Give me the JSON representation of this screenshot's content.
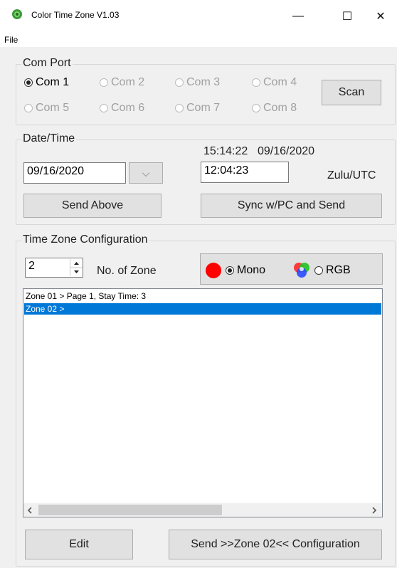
{
  "window": {
    "title": "Color Time Zone V1.03",
    "minimize_glyph": "—",
    "maximize_glyph": "☐",
    "close_glyph": "✕"
  },
  "menu": {
    "file": "File"
  },
  "com_port": {
    "legend": "Com Port",
    "options": [
      {
        "label": "Com 1",
        "selected": true,
        "enabled": true
      },
      {
        "label": "Com 2",
        "selected": false,
        "enabled": false
      },
      {
        "label": "Com 3",
        "selected": false,
        "enabled": false
      },
      {
        "label": "Com 4",
        "selected": false,
        "enabled": false
      },
      {
        "label": "Com 5",
        "selected": false,
        "enabled": false
      },
      {
        "label": "Com 6",
        "selected": false,
        "enabled": false
      },
      {
        "label": "Com 7",
        "selected": false,
        "enabled": false
      },
      {
        "label": "Com 8",
        "selected": false,
        "enabled": false
      }
    ],
    "scan_label": "Scan"
  },
  "date_time": {
    "legend": "Date/Time",
    "current_time": "15:14:22",
    "current_date": "09/16/2020",
    "date_value": "09/16/2020",
    "dropdown_glyph": "⌵",
    "time_value": "12:04:23",
    "zone_label": "Zulu/UTC",
    "send_above_label": "Send Above",
    "sync_label": "Sync w/PC and Send"
  },
  "tz_config": {
    "legend": "Time Zone Configuration",
    "zone_count": "2",
    "zone_count_label": "No. of Zone",
    "mono_label": "Mono",
    "rgb_label": "RGB",
    "mono_selected": true,
    "list": [
      "Zone 01 > Page 1, Stay Time: 3",
      "Zone 02 >"
    ],
    "selected_index": 1,
    "edit_label": "Edit",
    "send_label": "Send >>Zone 02<< Configuration"
  },
  "colors": {
    "selection": "#0078d7",
    "mono_dot": "#ff0000"
  }
}
